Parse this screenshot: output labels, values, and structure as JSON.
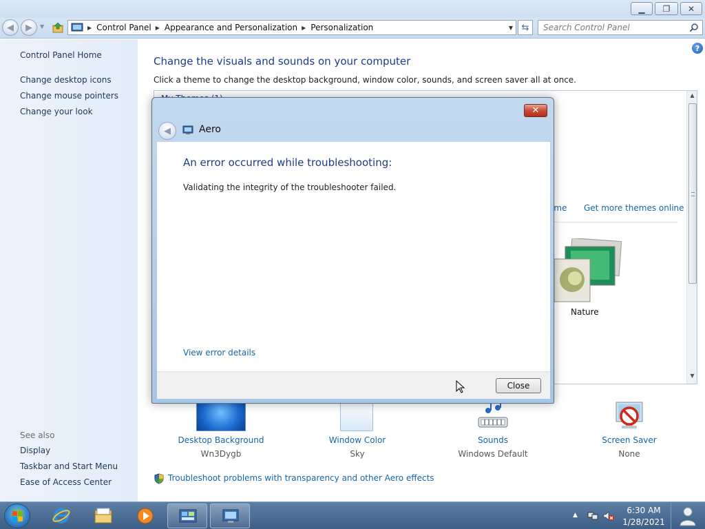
{
  "titlebar": {
    "minimize": "▁",
    "maximize": "❐",
    "close": "✕"
  },
  "nav": {
    "breadcrumbs": [
      "Control Panel",
      "Appearance and Personalization",
      "Personalization"
    ],
    "search_placeholder": "Search Control Panel"
  },
  "sidebar": {
    "home": "Control Panel Home",
    "links": [
      "Change desktop icons",
      "Change mouse pointers",
      "Change your look"
    ],
    "see_also_label": "See also",
    "see_also": [
      "Display",
      "Taskbar and Start Menu",
      "Ease of Access Center"
    ]
  },
  "main": {
    "title": "Change the visuals and sounds on your computer",
    "description": "Click a theme to change the desktop background, window color, sounds, and screen saver all at once.",
    "themes_header": "My Themes (1)",
    "save_theme_link": "eme",
    "get_more_themes_link": "Get more themes online",
    "theme_nature_label": "Nature",
    "help": "?"
  },
  "settings": [
    {
      "label": "Desktop Background",
      "value": "Wn3Dygb"
    },
    {
      "label": "Window Color",
      "value": "Sky"
    },
    {
      "label": "Sounds",
      "value": "Windows Default"
    },
    {
      "label": "Screen Saver",
      "value": "None"
    }
  ],
  "troubleshoot_link": "Troubleshoot problems with transparency and other Aero effects",
  "dialog": {
    "title": "Aero",
    "heading": "An error occurred while troubleshooting:",
    "message": "Validating the integrity of the troubleshooter failed.",
    "details_link": "View error details",
    "close_button": "Close",
    "close_icon": "✕"
  },
  "taskbar": {
    "time": "6:30 AM",
    "date": "1/28/2021",
    "tray_arrow": "▲",
    "icons": [
      "ie-icon",
      "explorer-icon",
      "media-player-icon",
      "control-panel-icon",
      "troubleshooter-icon"
    ]
  },
  "colors": {
    "link": "#1565a8",
    "heading": "#1e3a8c",
    "taskbar": "#3d5f86",
    "dialog_close": "#c74c37"
  }
}
